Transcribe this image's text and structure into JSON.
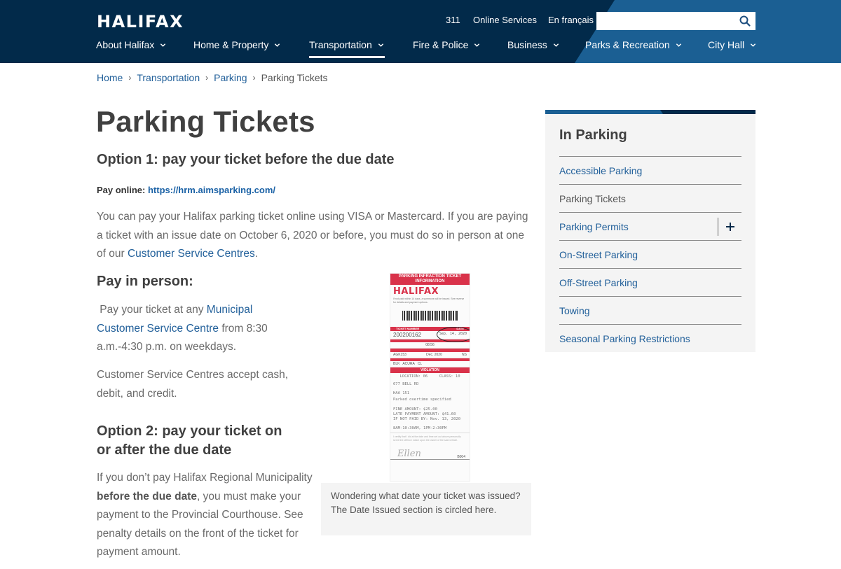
{
  "header": {
    "logo": "HALIFAX",
    "utility_links": [
      "311",
      "Online Services",
      "En français"
    ],
    "search": {
      "placeholder": "",
      "value": "",
      "icon": "search-icon"
    },
    "nav": [
      {
        "label": "About Halifax",
        "active": false
      },
      {
        "label": "Home & Property",
        "active": false
      },
      {
        "label": "Transportation",
        "active": true
      },
      {
        "label": "Fire & Police",
        "active": false
      },
      {
        "label": "Business",
        "active": false
      },
      {
        "label": "Parks & Recreation",
        "active": false
      },
      {
        "label": "City Hall",
        "active": false
      }
    ],
    "colors": {
      "navy": "#022a4a",
      "blue": "#1b5f93"
    }
  },
  "breadcrumb": {
    "items": [
      "Home",
      "Transportation",
      "Parking"
    ],
    "current": "Parking Tickets",
    "separator": "›"
  },
  "main": {
    "title": "Parking Tickets",
    "option1_heading": "Option 1: pay your ticket before the due date",
    "pay_online_label": "Pay online:",
    "pay_online_link": "https://hrm.aimsparking.com/",
    "option1_text": "You can pay your Halifax parking ticket online using VISA or Mastercard. If you are paying a ticket with an issue date on October 6, 2020 or before, you must do so in person at one of our ",
    "option1_link": "Customer Service Centres",
    "option1_end": ".",
    "in_person_heading": "Pay in person:",
    "in_person_text_1": " Pay your ticket at any ",
    "in_person_link": "Municipal Customer Service Centre",
    "in_person_text_2": " from 8:30 a.m.-4:30 p.m. on weekdays.",
    "accept_text": "Customer Service Centres accept cash, debit, and credit.",
    "option2_heading": "Option 2: pay your ticket on or after the due date",
    "option2_text_1": "If you don’t pay Halifax Regional Municipality ",
    "option2_bold": "before the due date",
    "option2_text_2": ", you must make your payment to the Provincial Courthouse. See penalty details on the front of the ticket for payment amount.",
    "figure": {
      "ticket": {
        "header": "PARKING INFRACTION TICKET INFORMATION",
        "logo": "HALIFAX",
        "ticket_number_label": "TICKET NUMBER",
        "ticket_number": "200200162",
        "date_label": "DATE",
        "date": "Sep. 14, 2020",
        "time": "08:56",
        "plate": "AGK153",
        "expiry": "Dec. 2020",
        "province": "NS",
        "vehicle": "BLK   ACURA   CL",
        "violation_label": "VIOLATION",
        "location_line": "LOCATION: 06     CLASS: 10",
        "street": "677   BELL RD",
        "section": "HAA 151",
        "offence": "Parked overtime specified",
        "fine": "FINE AMOUNT: $25.00",
        "late": "LATE PAYMENT AMOUNT: $41.60",
        "not_paid": "IF NOT PAID BY: Nov. 13, 2020",
        "hours": "8AM-10:30AM, 1PM-2:30PM",
        "signature": "Ellen",
        "officer": "B004"
      },
      "caption": "Wondering what date your ticket was issued? The Date Issued section is circled here."
    }
  },
  "sidebar": {
    "title": "In Parking",
    "items": [
      {
        "label": "Accessible Parking",
        "current": false,
        "expandable": false
      },
      {
        "label": "Parking Tickets",
        "current": true,
        "expandable": false
      },
      {
        "label": "Parking Permits",
        "current": false,
        "expandable": true
      },
      {
        "label": "On-Street Parking",
        "current": false,
        "expandable": false
      },
      {
        "label": "Off-Street Parking",
        "current": false,
        "expandable": false
      },
      {
        "label": "Towing",
        "current": false,
        "expandable": false
      },
      {
        "label": "Seasonal Parking Restrictions",
        "current": false,
        "expandable": false
      }
    ]
  }
}
